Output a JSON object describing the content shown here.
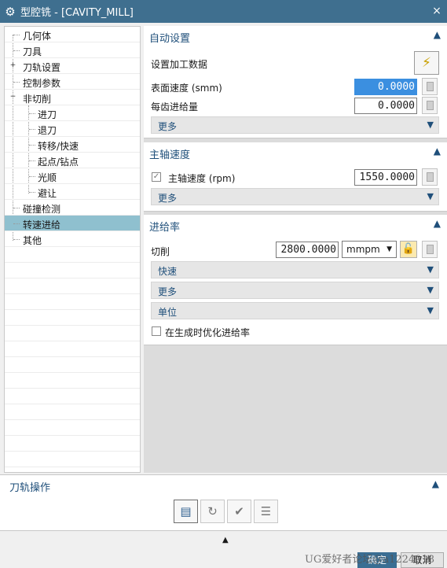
{
  "window": {
    "title": "型腔铣 - [CAVITY_MILL]",
    "close_label": "×"
  },
  "tree": {
    "items": [
      {
        "label": "几何体"
      },
      {
        "label": "刀具"
      },
      {
        "label": "刀轨设置",
        "expander": "+"
      },
      {
        "label": "控制参数"
      },
      {
        "label": "非切削",
        "expander": "−"
      },
      {
        "label": "进刀"
      },
      {
        "label": "退刀"
      },
      {
        "label": "转移/快速"
      },
      {
        "label": "起点/钻点"
      },
      {
        "label": "光顺"
      },
      {
        "label": "避让"
      },
      {
        "label": "碰撞检测"
      },
      {
        "label": "转速进给",
        "selected": true
      },
      {
        "label": "其他"
      }
    ]
  },
  "auto_settings": {
    "title": "自动设置",
    "set_data_label": "设置加工数据",
    "surface_speed_label": "表面速度 (smm)",
    "surface_speed_value": "0.0000",
    "feed_per_tooth_label": "每齿进给量",
    "feed_per_tooth_value": "0.0000",
    "more_label": "更多"
  },
  "spindle": {
    "title": "主轴速度",
    "speed_label": "主轴速度 (rpm)",
    "speed_checked": true,
    "speed_value": "1550.0000",
    "more_label": "更多"
  },
  "feed": {
    "title": "进给率",
    "cut_label": "切削",
    "cut_value": "2800.0000",
    "unit_selected": "mmpm",
    "rapid_label": "快速",
    "more_label": "更多",
    "units_label": "单位",
    "optimize_label": "在生成时优化进给率",
    "optimize_checked": false
  },
  "toolpath_ops": {
    "title": "刀轨操作"
  },
  "footer": {
    "ok_label": "确定",
    "cancel_label": "取消",
    "watermark": "UG爱好者论坛@a1224918"
  },
  "icons": {
    "window": "gear-icon",
    "generate": "lightning-icon",
    "lock": "lock-icon",
    "collapse": "chevron-up-icon",
    "expand": "chevron-down-icon"
  },
  "colors": {
    "titlebar": "#3f6f8f",
    "section_title": "#1f4f7a",
    "tree_selected": "#8fc0cf",
    "input_highlight": "#3b8fe0"
  }
}
